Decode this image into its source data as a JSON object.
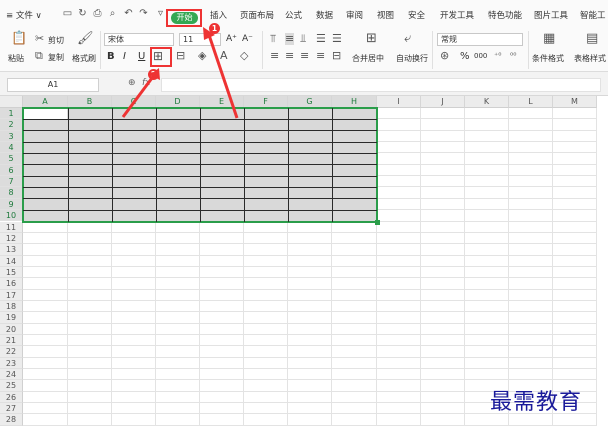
{
  "menu": {
    "file": "≡ 文件 ∨",
    "start": "开始",
    "tabs": [
      "插入",
      "页面布局",
      "公式",
      "数据",
      "审阅",
      "视图",
      "安全",
      "开发工具",
      "特色功能",
      "图片工具",
      "智能工"
    ]
  },
  "ribbon": {
    "paste": "粘贴",
    "cut": "剪切",
    "copy": "复制",
    "format_painter": "格式刷",
    "font_name": "宋体",
    "font_size": "11",
    "bold": "B",
    "italic": "I",
    "underline": "U",
    "increase_font": "A⁺",
    "decrease_font": "A⁻",
    "merge_center": "合并居中",
    "wrap_text": "自动换行",
    "number_format": "常规",
    "percent": "%",
    "thousands": "000",
    "conditional_format": "条件格式",
    "table_style": "表格样式"
  },
  "formula_bar": {
    "name_box": "A1",
    "fx": "fx"
  },
  "sheet": {
    "columns": [
      "A",
      "B",
      "C",
      "D",
      "E",
      "F",
      "G",
      "H",
      "I",
      "J",
      "K",
      "L",
      "M"
    ],
    "rows": [
      "1",
      "2",
      "3",
      "4",
      "5",
      "6",
      "7",
      "8",
      "9",
      "10",
      "11",
      "12",
      "13",
      "14",
      "15",
      "16",
      "17",
      "18",
      "19",
      "20",
      "21",
      "22",
      "23",
      "24",
      "25",
      "26",
      "27",
      "28"
    ],
    "selected_range": "A1:H10"
  },
  "annotations": {
    "step1": "1",
    "step2": "2",
    "color": "#ee3333"
  },
  "watermark": "最需教育"
}
